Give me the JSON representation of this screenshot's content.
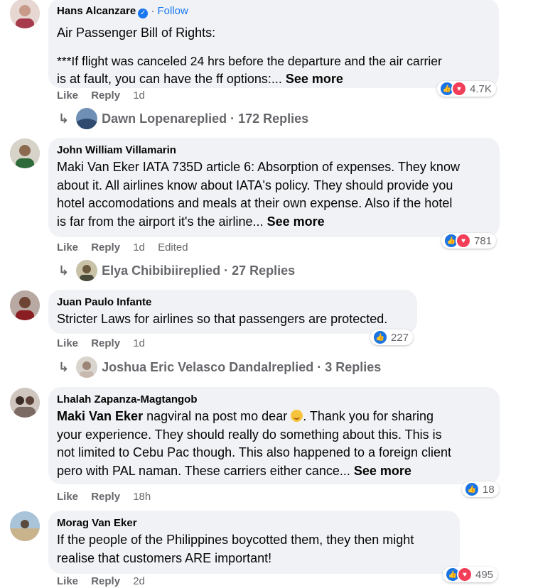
{
  "comments": [
    {
      "author": "Hans Alcanzare",
      "verified": true,
      "follow": "Follow",
      "separator": "·",
      "lines": [
        "Air Passenger Bill of Rights:",
        "***If flight was canceled 24 hrs before the departure and the air carrier",
        "is at fault, you can have the ff options:..."
      ],
      "see_more": "See more",
      "like": "Like",
      "reply": "Reply",
      "time": "1d",
      "reactions": {
        "types": [
          "like",
          "love"
        ],
        "count": "4.7K"
      },
      "replies": {
        "name": "Dawn Lopena",
        "text": " replied · 172 Replies"
      }
    },
    {
      "author": "John William Villamarin",
      "lines": [
        "Maki Van Eker IATA 735D article 6: Absorption of expenses. They know",
        "about it. All airlines know about IATA's policy. They should provide you",
        "hotel accomodations and meals at their own expense. Also if the hotel",
        "is far from the airport it's the airline..."
      ],
      "see_more": "See more",
      "like": "Like",
      "reply": "Reply",
      "time": "1d",
      "edited": "Edited",
      "reactions": {
        "types": [
          "like",
          "love"
        ],
        "count": "781"
      },
      "replies": {
        "name": "Elya Chibibii",
        "text": " replied · 27 Replies"
      }
    },
    {
      "author": "Juan Paulo Infante",
      "lines": [
        "Stricter Laws for airlines so that passengers are protected."
      ],
      "like": "Like",
      "reply": "Reply",
      "time": "1d",
      "reactions": {
        "types": [
          "like"
        ],
        "count": "227"
      },
      "replies": {
        "name": "Joshua Eric Velasco Dandal",
        "text": " replied · 3 Replies"
      }
    },
    {
      "author": "Lhalah Zapanza-Magtangob",
      "mention": "Maki Van Eker",
      "first_line_rest": " nagviral na post mo dear ",
      "first_line_after_emoji": ". Thank you for sharing",
      "lines": [
        "your experience. They should really do something about this. This is",
        "not limited to Cebu Pac though. This also happened to a foreign client",
        "pero with PAL naman. These carriers either cance..."
      ],
      "see_more": "See more",
      "like": "Like",
      "reply": "Reply",
      "time": "18h",
      "reactions": {
        "types": [
          "like"
        ],
        "count": "18"
      }
    },
    {
      "author": "Morag Van Eker",
      "lines": [
        "If the people of the Philippines boycotted them, they then might",
        "realise that customers ARE important!"
      ],
      "like": "Like",
      "reply": "Reply",
      "time": "2d",
      "reactions": {
        "types": [
          "like",
          "love"
        ],
        "count": "495"
      }
    }
  ],
  "icons": {
    "like": "thumbs-up-icon",
    "love": "heart-icon",
    "reply_arrow": "reply-arrow-icon",
    "verified": "verified-badge-icon"
  },
  "colors": {
    "bubble": "#f0f2f5",
    "secondary_text": "#65676b",
    "link": "#1877f2",
    "like": "#1b74e4",
    "love": "#f33e58"
  }
}
